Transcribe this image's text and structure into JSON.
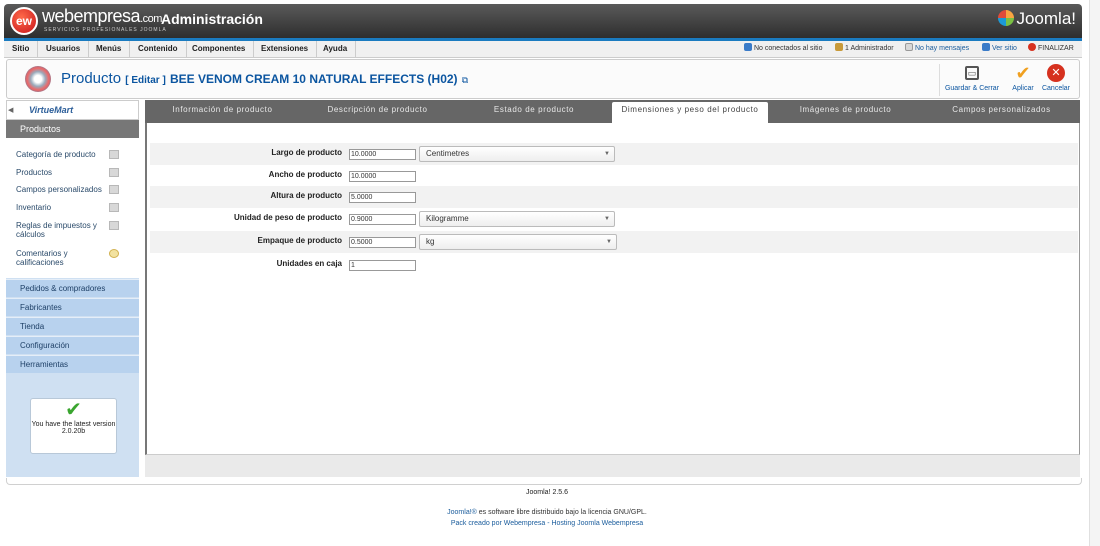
{
  "header": {
    "logo_text": "ew",
    "brand": "webempresa",
    "brand_suffix": ".com",
    "brand_sub": "SERVICIOS PROFESIONALES JOOMLA",
    "title": "Administración",
    "joomla_text": "Joomla!"
  },
  "menubar": {
    "items": [
      "Sitio",
      "Usuarios",
      "Menús",
      "Contenido",
      "Componentes",
      "Extensiones",
      "Ayuda"
    ],
    "status": {
      "visitors": "No conectados al sitio",
      "admins": "1 Administrador",
      "messages": "No hay mensajes",
      "view_site": "Ver sitio",
      "logout": "FINALIZAR"
    }
  },
  "toolbar": {
    "title": "Producto",
    "edit_label": "[ Editar ]",
    "product_name": "BEE VENOM CREAM 10 NATURAL EFFECTS (H02)",
    "save_close": "Guardar & Cerrar",
    "apply": "Aplicar",
    "cancel": "Cancelar"
  },
  "sidebar": {
    "logo": "VirtueMart",
    "active_section": "Productos",
    "links": [
      "Categoría de producto",
      "Productos",
      "Campos personalizados",
      "Inventario",
      "Reglas de impuestos y cálculos",
      "Comentarios y calificaciones"
    ],
    "sections": [
      "Pedidos & compradores",
      "Fabricantes",
      "Tienda",
      "Configuración",
      "Herramientas"
    ],
    "version_box": {
      "line1": "You have the latest version",
      "version": "2.0.20b"
    }
  },
  "tabs": [
    "Información de producto",
    "Descripción de producto",
    "Estado de producto",
    "Dimensiones y peso del producto",
    "Imágenes de producto",
    "Campos personalizados"
  ],
  "active_tab": "Dimensiones y peso del producto",
  "form": {
    "length_label": "Largo de producto",
    "length_value": "10.0000",
    "length_unit": "Centimetres",
    "width_label": "Ancho de producto",
    "width_value": "10.0000",
    "height_label": "Altura de producto",
    "height_value": "5.0000",
    "weight_label": "Unidad de peso de producto",
    "weight_value": "0.9000",
    "weight_unit": "Kilogramme",
    "packaging_label": "Empaque de producto",
    "packaging_value": "0.5000",
    "packaging_unit": "kg",
    "box_label": "Unidades en caja",
    "box_value": "1"
  },
  "footer": {
    "version": "Joomla! 2.5.6",
    "license_link": "Joomla!®",
    "license_text": " es software libre distribuido bajo la licencia GNU/GPL.",
    "pack_text": "Pack creado por Webempresa - Hosting Joomla Webempresa"
  }
}
